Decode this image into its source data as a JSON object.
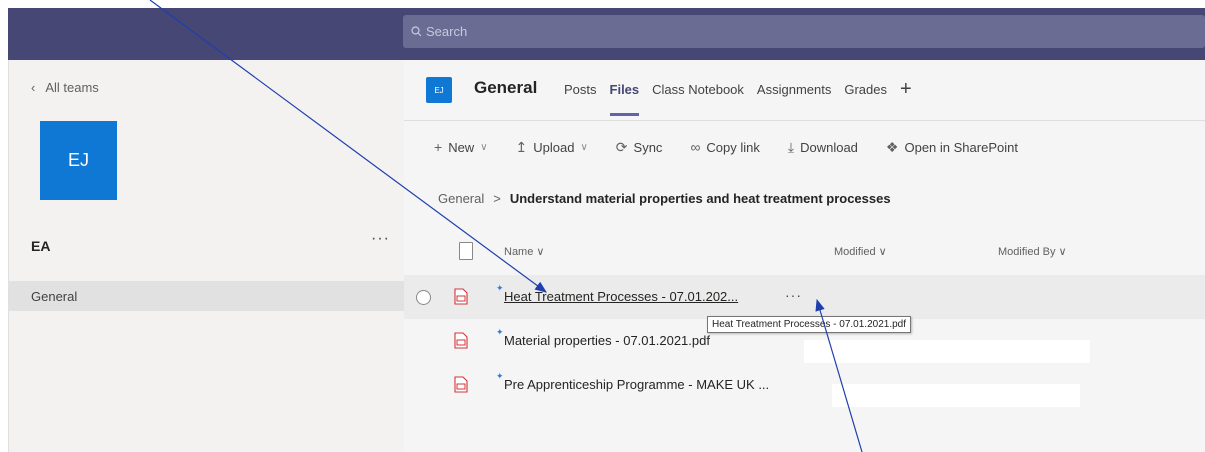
{
  "search": {
    "placeholder": "Search"
  },
  "sidebar": {
    "back_label": "All teams",
    "team_avatar_text": "EJ",
    "team_name": "EA",
    "more_label": "···",
    "channels": [
      {
        "label": "General"
      }
    ]
  },
  "channel_header": {
    "icon_text": "EJ",
    "title": "General",
    "tabs": [
      {
        "label": "Posts"
      },
      {
        "label": "Files",
        "active": true
      },
      {
        "label": "Class Notebook"
      },
      {
        "label": "Assignments"
      },
      {
        "label": "Grades"
      }
    ],
    "add_tab_label": "+"
  },
  "toolbar": {
    "new_label": "New",
    "upload_label": "Upload",
    "sync_label": "Sync",
    "copy_link_label": "Copy link",
    "download_label": "Download",
    "open_sharepoint_label": "Open in SharePoint"
  },
  "breadcrumb": {
    "root": "General",
    "current": "Understand material properties and heat treatment processes"
  },
  "file_list": {
    "columns": {
      "name": "Name",
      "modified": "Modified",
      "modified_by": "Modified By"
    },
    "rows": [
      {
        "name": "Heat Treatment Processes - 07.01.202...",
        "more": "···"
      },
      {
        "name": "Material properties - 07.01.2021.pdf"
      },
      {
        "name": "Pre Apprenticeship Programme - MAKE UK ..."
      }
    ],
    "tooltip": "Heat Treatment Processes - 07.01.2021.pdf"
  },
  "colors": {
    "header_purple": "#464775",
    "accent": "#6264a7",
    "team_blue": "#0f78d4",
    "pdf_red": "#d13438",
    "annotation_arrow": "#1f3fae"
  }
}
